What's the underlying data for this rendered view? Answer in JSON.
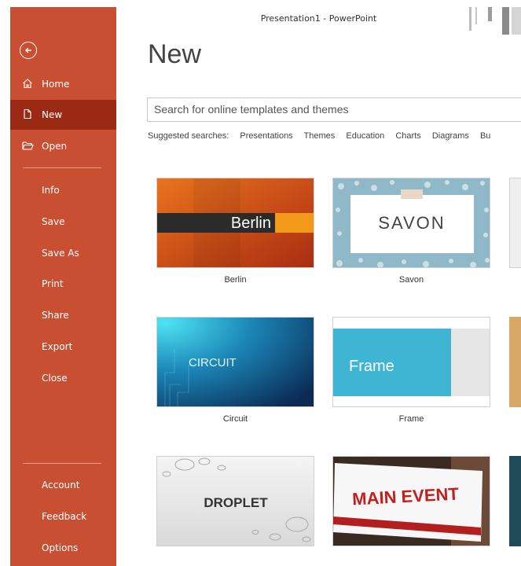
{
  "window": {
    "title": "Presentation1 - PowerPoint"
  },
  "sidebar": {
    "back_icon": "back-arrow-icon",
    "top_items": [
      {
        "label": "Home",
        "icon": "home-icon"
      },
      {
        "label": "New",
        "icon": "new-file-icon",
        "active": true
      },
      {
        "label": "Open",
        "icon": "folder-open-icon"
      }
    ],
    "middle_items": [
      "Info",
      "Save",
      "Save As",
      "Print",
      "Share",
      "Export",
      "Close"
    ],
    "bottom_items": [
      "Account",
      "Feedback",
      "Options"
    ]
  },
  "page": {
    "heading": "New",
    "search_placeholder": "Search for online templates and themes",
    "suggested_label": "Suggested searches:",
    "suggested": [
      "Presentations",
      "Themes",
      "Education",
      "Charts",
      "Diagrams",
      "Bu"
    ]
  },
  "templates": [
    {
      "name": "Berlin",
      "thumb_text": "Berlin"
    },
    {
      "name": "Savon",
      "thumb_text": "SAVON"
    },
    {
      "name": "Circuit",
      "thumb_text": "CIRCUIT"
    },
    {
      "name": "Frame",
      "thumb_text": "Frame"
    },
    {
      "name": "",
      "thumb_text": "DROPLET"
    },
    {
      "name": "",
      "thumb_text": "MAIN EVENT"
    }
  ],
  "colors": {
    "sidebar_bg": "#c94f33",
    "sidebar_active": "#9b2a14",
    "accent": "#c43e1c"
  }
}
